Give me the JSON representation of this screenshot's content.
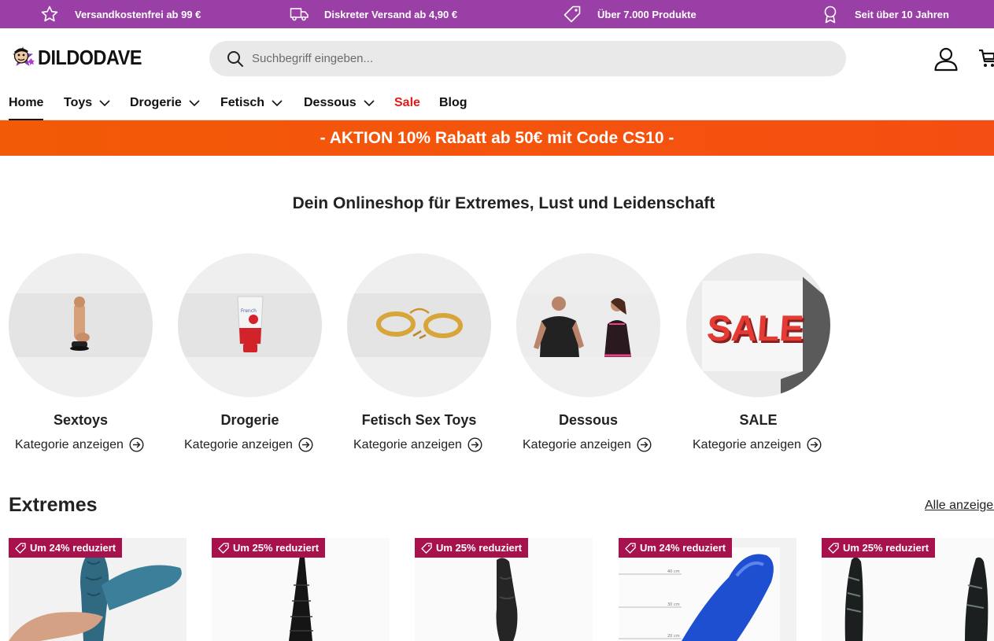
{
  "announcements": [
    {
      "icon": "star-icon",
      "text": "Versandkostenfrei ab 99 €"
    },
    {
      "icon": "truck-icon",
      "text": "Diskreter Versand ab 4,90 €"
    },
    {
      "icon": "tag-icon",
      "text": "Über 7.000 Produkte"
    },
    {
      "icon": "award-icon",
      "text": "Seit über 10 Jahren"
    }
  ],
  "header": {
    "logo_text": "DILDODAVE",
    "search_placeholder": "Suchbegriff eingeben..."
  },
  "nav": [
    {
      "label": "Home",
      "active": true,
      "dropdown": false
    },
    {
      "label": "Toys",
      "dropdown": true
    },
    {
      "label": "Drogerie",
      "dropdown": true
    },
    {
      "label": "Fetisch",
      "dropdown": true
    },
    {
      "label": "Dessous",
      "dropdown": true
    },
    {
      "label": "Sale",
      "dropdown": false,
      "color": "#e21a1a"
    },
    {
      "label": "Blog",
      "dropdown": false
    }
  ],
  "promo": "- AKTION 10% Rabatt ab 50€ mit Code CS10 -",
  "hero_title": "Dein Onlineshop für Extremes, Lust und Leidenschaft",
  "categories": [
    {
      "name": "Sextoys",
      "link": "Kategorie anzeigen"
    },
    {
      "name": "Drogerie",
      "link": "Kategorie anzeigen"
    },
    {
      "name": "Fetisch Sex Toys",
      "link": "Kategorie anzeigen"
    },
    {
      "name": "Dessous",
      "link": "Kategorie anzeigen"
    },
    {
      "name": "SALE",
      "link": "Kategorie anzeigen"
    }
  ],
  "section": {
    "title": "Extremes",
    "see_all": "Alle anzeigen"
  },
  "products": [
    {
      "badge": "Um 24% reduziert"
    },
    {
      "badge": "Um 25% reduziert"
    },
    {
      "badge": "Um 25% reduziert"
    },
    {
      "badge": "Um 24% reduziert"
    },
    {
      "badge": "Um 25% reduziert"
    }
  ],
  "colors": {
    "topbar": "#9a3fa6",
    "promo": "#f25a06",
    "badge": "#a8124c",
    "sale_nav": "#e21a1a"
  }
}
